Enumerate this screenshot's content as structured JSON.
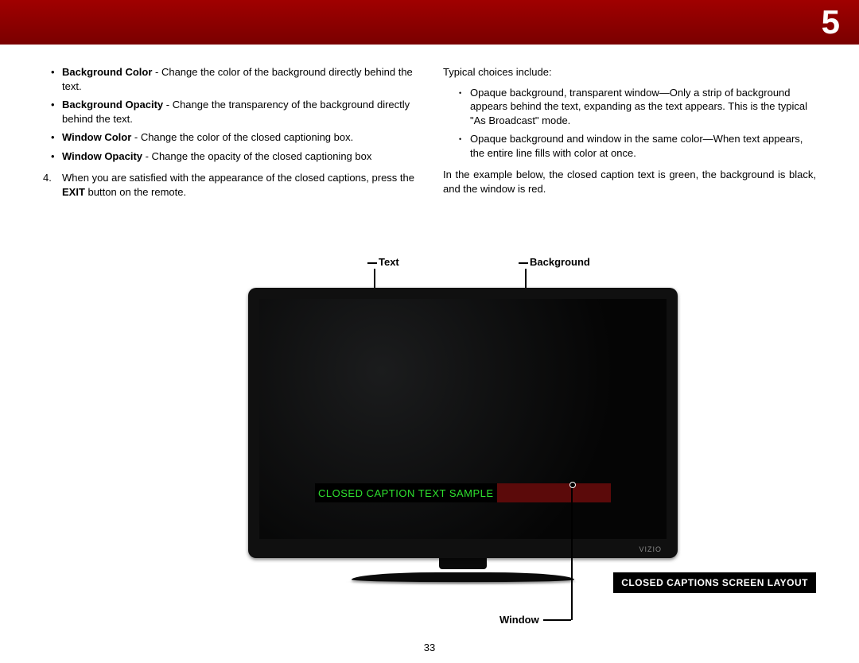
{
  "header": {
    "chapter": "5"
  },
  "left": {
    "bullets": [
      {
        "term": "Background Color",
        "desc": " - Change the color of the background directly behind the text."
      },
      {
        "term": "Background Opacity",
        "desc": " - Change the transparency of the background directly behind the text."
      },
      {
        "term": "Window Color",
        "desc": " - Change the color of the closed captioning box."
      },
      {
        "term": "Window Opacity",
        "desc": " - Change the opacity of the closed captioning box"
      }
    ],
    "step": {
      "num": "4.",
      "pre": "When you are satisfied with the appearance of the closed captions, press the",
      "bold": "EXIT",
      "post": "button on the remote."
    }
  },
  "right": {
    "intro": "Typical choices include:",
    "sub": [
      "Opaque background, transparent window—Only a strip of background appears behind the text, expanding as the text appears. This is the typical \"As Broadcast\" mode.",
      "Opaque background and window in the same color—When text appears, the entire line fills with color at once."
    ],
    "example": "In the example below, the closed caption text is green, the background is black, and the window is red."
  },
  "diagram": {
    "labels": {
      "text": "Text",
      "background": "Background",
      "window": "Window"
    },
    "caption_text": "CLOSED CAPTION TEXT SAMPLE",
    "brand": "VIZIO",
    "title": "CLOSED CAPTIONS SCREEN LAYOUT"
  },
  "footer": {
    "page": "33"
  }
}
